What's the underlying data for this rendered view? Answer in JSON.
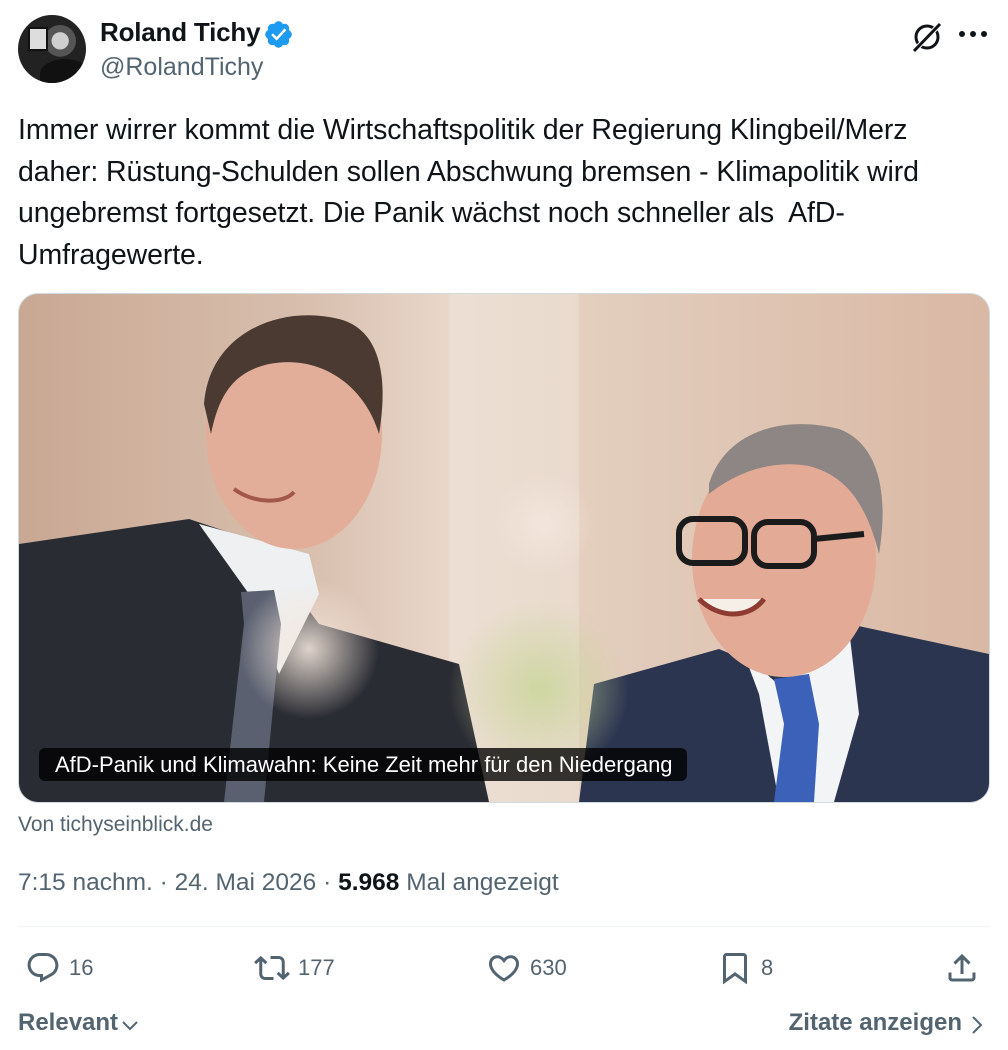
{
  "author": {
    "name": "Roland Tichy",
    "handle": "@RolandTichy",
    "verified": true
  },
  "header_icons": [
    "grok-icon",
    "more-icon"
  ],
  "tweet": {
    "text": "Immer wirrer kommt die Wirtschaftspolitik der Regierung Klingbeil/Merz\ndaher: Rüstung-Schulden sollen Abschwung bremsen - Klimapolitik wird\nungebremst fortgesetzt. Die Panik wächst noch schneller als  AfD-\nUmfragewerte."
  },
  "card": {
    "caption": "AfD-Panik und Klimawahn: Keine Zeit mehr für den Niedergang",
    "source": "Von tichyseinblick.de"
  },
  "meta": {
    "time": "7:15 nachm.",
    "date": "24. Mai 2026",
    "views_count": "5.968",
    "views_label": "Mal angezeigt"
  },
  "actions": {
    "replies": "16",
    "reposts": "177",
    "likes": "630",
    "bookmarks": "8"
  },
  "footer": {
    "sort_label": "Relevant",
    "quotes_label": "Zitate anzeigen"
  },
  "colors": {
    "verified": "#1d9bf0",
    "secondary_text": "#536471",
    "primary_text": "#0f1419"
  }
}
